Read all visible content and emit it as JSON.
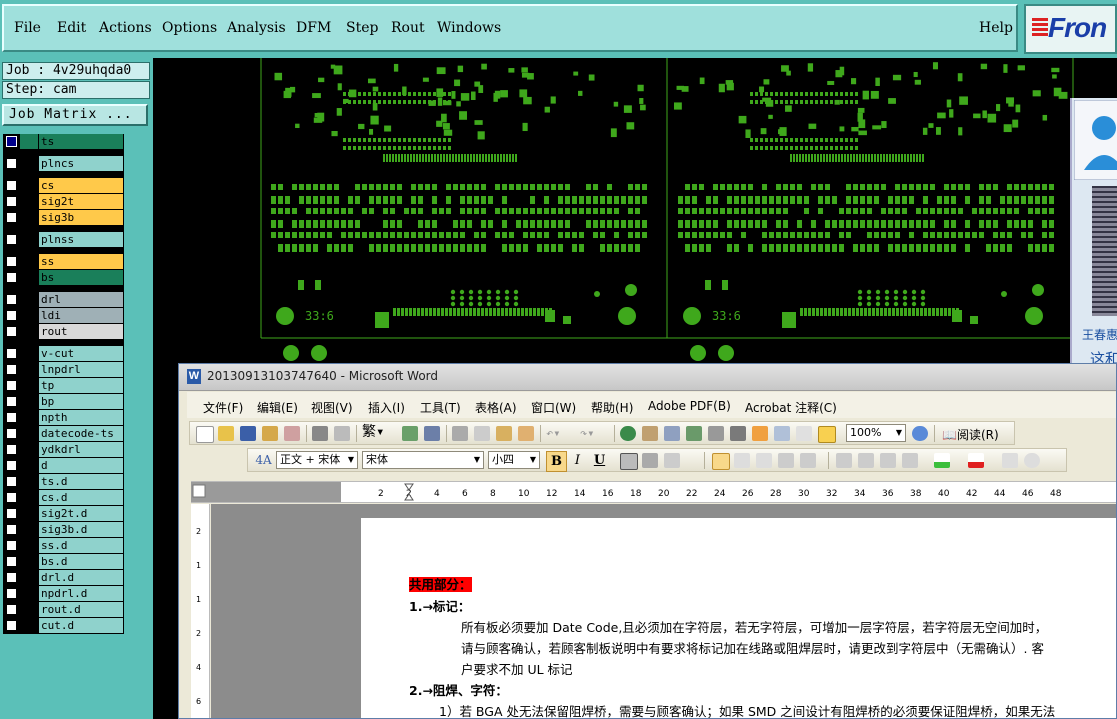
{
  "genesis": {
    "menu": [
      "File",
      "Edit",
      "Actions",
      "Options",
      "Analysis",
      "DFM",
      "Step",
      "Rout",
      "Windows"
    ],
    "help": "Help",
    "brand": "Fron",
    "job_label": "Job : 4v29uhqda0",
    "step_label": "Step: cam",
    "job_matrix_button": "Job Matrix ...",
    "layers": [
      {
        "name": "ts",
        "swatch": "#1a7f5a",
        "bg": "#1a7f5a",
        "checked": true
      },
      {
        "name": "plncs",
        "swatch": "#000000",
        "bg": "#8fd2cc",
        "checked": false
      },
      {
        "name": "cs",
        "swatch": "#000000",
        "bg": "#ffc94a",
        "checked": false
      },
      {
        "name": "sig2t",
        "swatch": "#000000",
        "bg": "#ffc94a",
        "checked": false
      },
      {
        "name": "sig3b",
        "swatch": "#000000",
        "bg": "#ffc94a",
        "checked": false
      },
      {
        "name": "plnss",
        "swatch": "#000000",
        "bg": "#8fd2cc",
        "checked": false
      },
      {
        "name": "ss",
        "swatch": "#000000",
        "bg": "#ffc94a",
        "checked": false
      },
      {
        "name": "bs",
        "swatch": "#000000",
        "bg": "#1a7f5a",
        "checked": false
      },
      {
        "name": "drl",
        "swatch": "#000000",
        "bg": "#9fb0b6",
        "checked": false
      },
      {
        "name": "ldi",
        "swatch": "#000000",
        "bg": "#9fb0b6",
        "checked": false
      },
      {
        "name": "rout",
        "swatch": "#000000",
        "bg": "#d8d8d8",
        "checked": false
      },
      {
        "name": "v-cut",
        "swatch": "#000000",
        "bg": "#8fd2cc",
        "checked": false
      },
      {
        "name": "lnpdrl",
        "swatch": "#000000",
        "bg": "#8fd2cc",
        "checked": false
      },
      {
        "name": "tp",
        "swatch": "#000000",
        "bg": "#8fd2cc",
        "checked": false
      },
      {
        "name": "bp",
        "swatch": "#000000",
        "bg": "#8fd2cc",
        "checked": false
      },
      {
        "name": "npth",
        "swatch": "#000000",
        "bg": "#8fd2cc",
        "checked": false
      },
      {
        "name": "datecode-ts",
        "swatch": "#000000",
        "bg": "#8fd2cc",
        "checked": false
      },
      {
        "name": "ydkdrl",
        "swatch": "#000000",
        "bg": "#8fd2cc",
        "checked": false
      },
      {
        "name": "d",
        "swatch": "#000000",
        "bg": "#8fd2cc",
        "checked": false
      },
      {
        "name": "ts.d",
        "swatch": "#000000",
        "bg": "#8fd2cc",
        "checked": false
      },
      {
        "name": "cs.d",
        "swatch": "#000000",
        "bg": "#8fd2cc",
        "checked": false
      },
      {
        "name": "sig2t.d",
        "swatch": "#000000",
        "bg": "#8fd2cc",
        "checked": false
      },
      {
        "name": "sig3b.d",
        "swatch": "#000000",
        "bg": "#8fd2cc",
        "checked": false
      },
      {
        "name": "ss.d",
        "swatch": "#000000",
        "bg": "#8fd2cc",
        "checked": false
      },
      {
        "name": "bs.d",
        "swatch": "#000000",
        "bg": "#8fd2cc",
        "checked": false
      },
      {
        "name": "drl.d",
        "swatch": "#000000",
        "bg": "#8fd2cc",
        "checked": false
      },
      {
        "name": "npdrl.d",
        "swatch": "#000000",
        "bg": "#8fd2cc",
        "checked": false
      },
      {
        "name": "rout.d",
        "swatch": "#000000",
        "bg": "#8fd2cc",
        "checked": false
      },
      {
        "name": "cut.d",
        "swatch": "#000000",
        "bg": "#8fd2cc",
        "checked": false
      }
    ],
    "canvas_label_left": "33:6",
    "canvas_label_right": "33:6",
    "pad_color": "#3fa81c"
  },
  "side_photo": {
    "name_line1": "王春惠",
    "name_line2": "这和"
  },
  "word": {
    "title": "20130913103747640 - Microsoft Word",
    "logo": "W",
    "menu": [
      "文件(F)",
      "编辑(E)",
      "视图(V)",
      "插入(I)",
      "工具(T)",
      "表格(A)",
      "窗口(W)",
      "帮助(H)",
      "Adobe PDF(B)",
      "Acrobat 注释(C)"
    ],
    "zoom": "100%",
    "reading": "阅读(R)",
    "style": "正文 + 宋体",
    "font": "宋体",
    "size": "小四",
    "bold_btn": "B",
    "italic_btn": "I",
    "underline_btn": "U",
    "ruler_numbers": [
      "2",
      "2",
      "4",
      "6",
      "8",
      "10",
      "12",
      "14",
      "16",
      "18",
      "20",
      "22",
      "24",
      "26",
      "28",
      "30",
      "32",
      "34",
      "36",
      "38",
      "40",
      "42",
      "44",
      "46",
      "48"
    ],
    "vruler_numbers": [
      "2",
      "1",
      "1",
      "2",
      "4",
      "6"
    ],
    "doc": {
      "heading": "共用部分：",
      "item1": "1.→标记：",
      "item1_line1": "所有板必须要加 Date Code,且必须加在字符层，若无字符层，可增加一层字符层，若字符层无空间加时，",
      "item1_line2": "请与顾客确认，若顾客制板说明中有要求将标记加在线路或阻焊层时，请更改到字符层中（无需确认）. 客",
      "item1_line3": "户要求不加 UL 标记",
      "item2": "2.→阻焊、字符：",
      "item2_line1": "1）若 BGA 处无法保留阻焊桥，需要与顾客确认；如果 SMD 之间设计有阻焊桥的必须要保证阻焊桥，如果无法"
    }
  }
}
